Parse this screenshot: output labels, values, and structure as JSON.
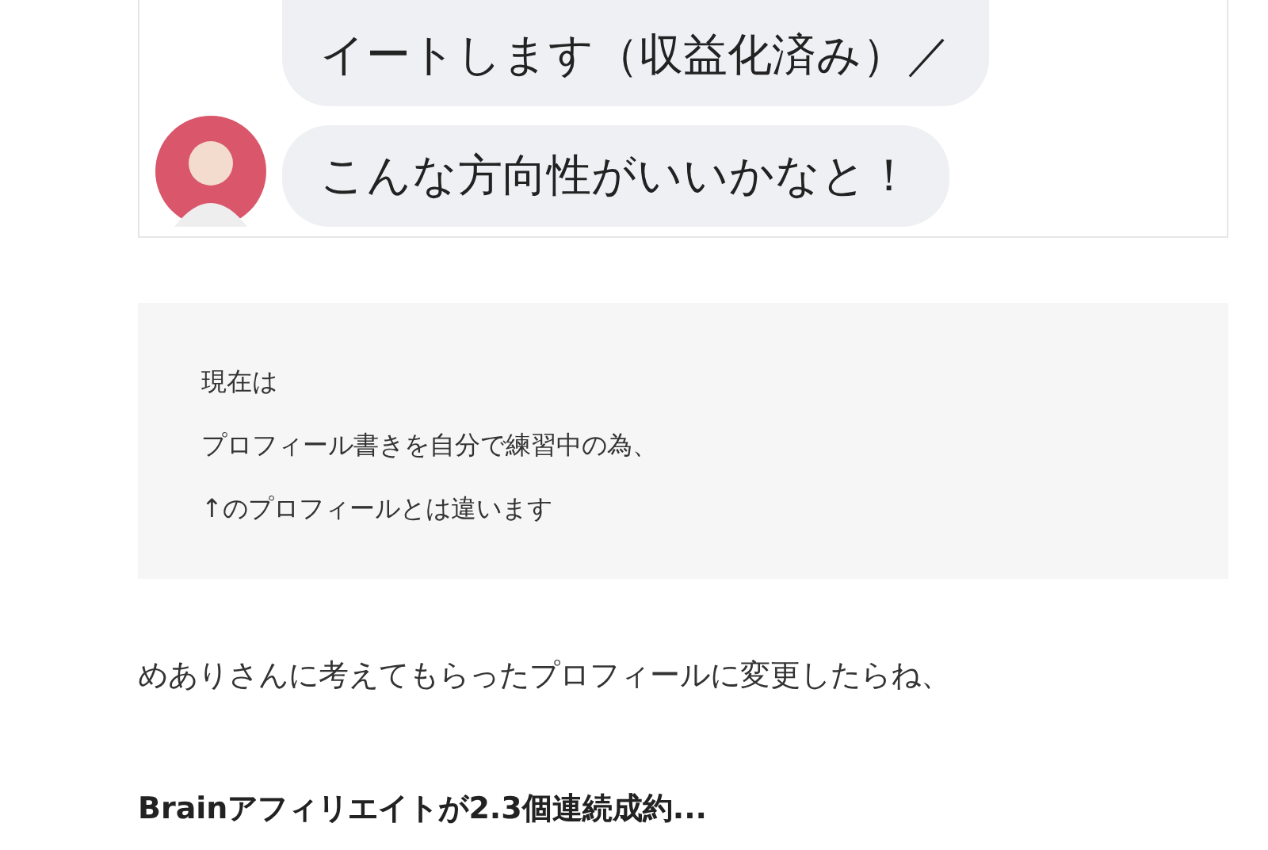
{
  "chat_image": {
    "messages": [
      {
        "text": "イートします（収益化済み）／"
      },
      {
        "text": "こんな方向性がいいかなと！"
      }
    ]
  },
  "note": {
    "lines": [
      "現在は",
      "プロフィール書きを自分で練習中の為、",
      "↑のプロフィールとは違います"
    ]
  },
  "paragraph": "めありさんに考えてもらったプロフィールに変更したらね、",
  "heading": "Brainアフィリエイトが2.3個連続成約..."
}
